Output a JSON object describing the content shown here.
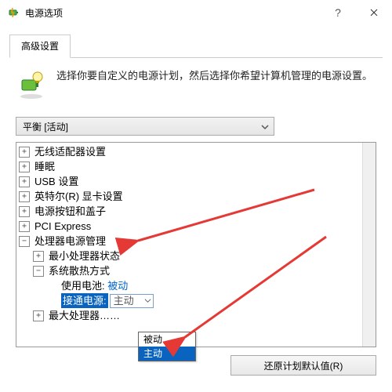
{
  "window": {
    "title": "电源选项"
  },
  "tab": {
    "label": "高级设置"
  },
  "panel": {
    "description": "选择你要自定义的电源计划，然后选择你希望计算机管理的电源设置。"
  },
  "plan": {
    "selected": "平衡 [活动]"
  },
  "tree": {
    "items": [
      {
        "exp": "+",
        "indent": 0,
        "label": "无线适配器设置"
      },
      {
        "exp": "+",
        "indent": 0,
        "label": "睡眠"
      },
      {
        "exp": "+",
        "indent": 0,
        "label": "USB 设置"
      },
      {
        "exp": "+",
        "indent": 0,
        "label": "英特尔(R) 显卡设置"
      },
      {
        "exp": "+",
        "indent": 0,
        "label": "电源按钮和盖子"
      },
      {
        "exp": "+",
        "indent": 0,
        "label": "PCI Express"
      },
      {
        "exp": "−",
        "indent": 0,
        "label": "处理器电源管理"
      },
      {
        "exp": "+",
        "indent": 1,
        "label": "最小处理器状态"
      },
      {
        "exp": "−",
        "indent": 1,
        "label": "系统散热方式"
      }
    ],
    "battery_row": {
      "key": "使用电池:",
      "value": "被动"
    },
    "plugged_row": {
      "key": "接通电源:",
      "value": "主动"
    },
    "cutoff_row": {
      "exp": "+",
      "label": "最大处理器……"
    }
  },
  "dropdown": {
    "option_passive": "被动",
    "option_active": "主动"
  },
  "buttons": {
    "restore": "还原计划默认值(R)"
  }
}
